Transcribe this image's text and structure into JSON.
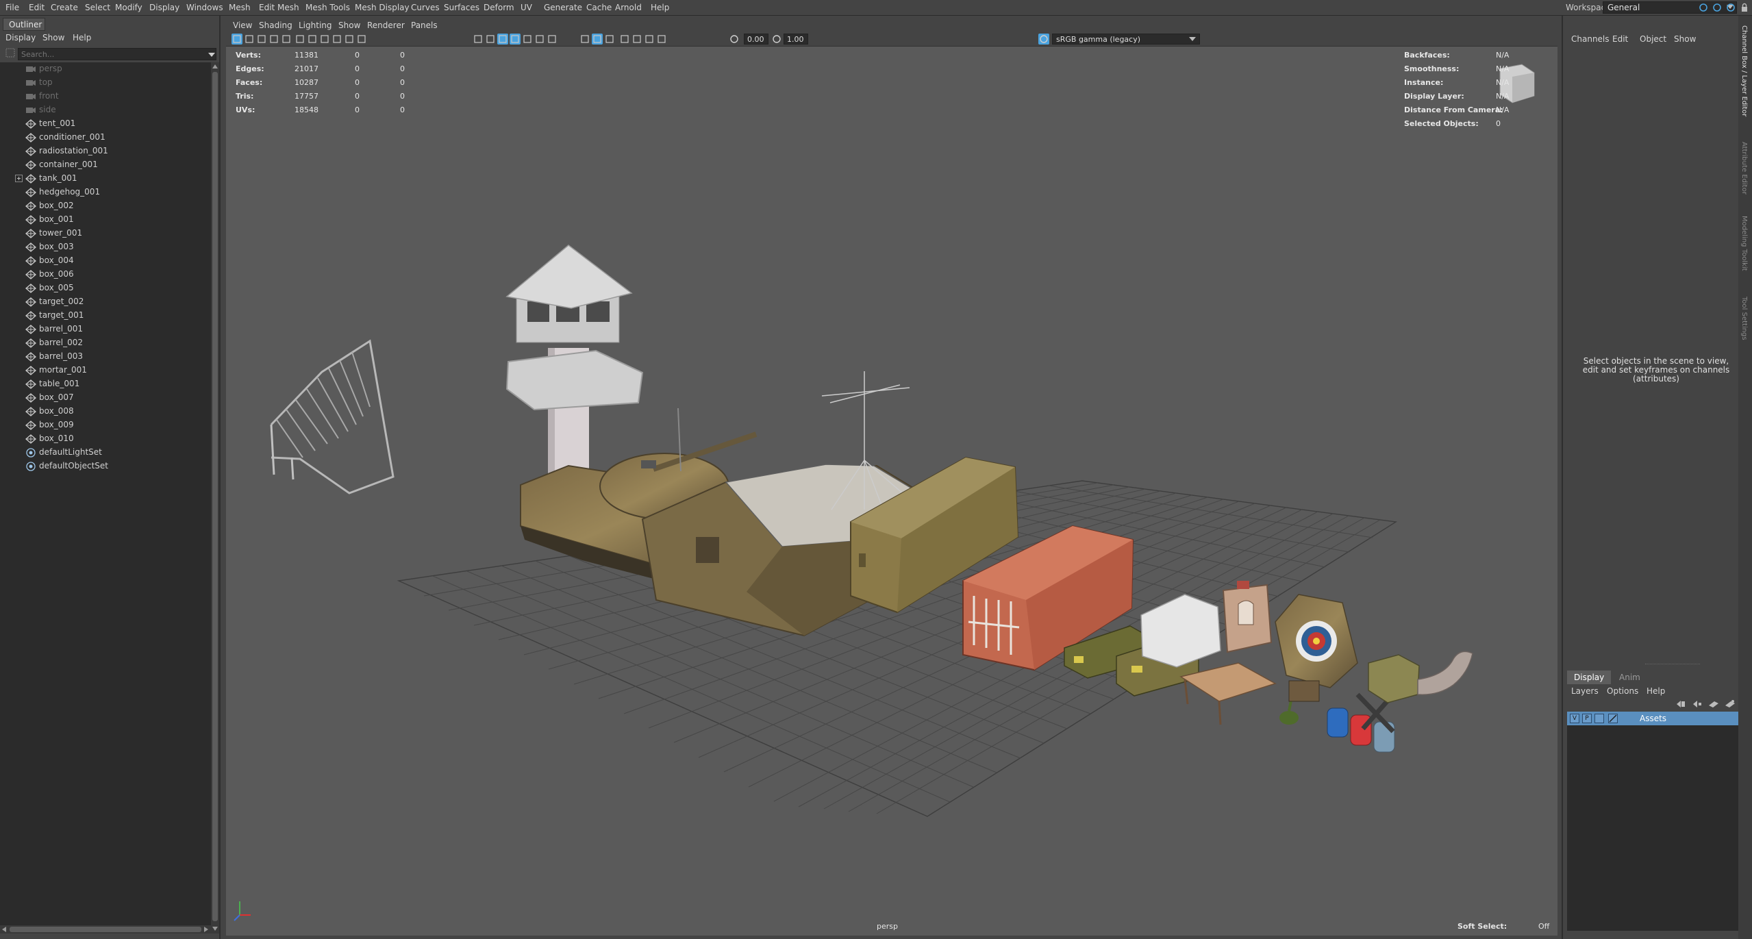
{
  "menubar": {
    "items": [
      "File",
      "Edit",
      "Create",
      "Select",
      "Modify",
      "Display",
      "Windows",
      "Mesh",
      "Edit Mesh",
      "Mesh Tools",
      "Mesh Display",
      "Curves",
      "Surfaces",
      "Deform",
      "UV",
      "Generate",
      "Cache",
      "Arnold",
      "Help"
    ],
    "workspace_label": "Workspace:",
    "workspace_value": "General"
  },
  "outliner": {
    "tab": "Outliner",
    "menu": [
      "Display",
      "Show",
      "Help"
    ],
    "search_placeholder": "Search...",
    "items": [
      {
        "label": "persp",
        "type": "camera"
      },
      {
        "label": "top",
        "type": "camera"
      },
      {
        "label": "front",
        "type": "camera"
      },
      {
        "label": "side",
        "type": "camera"
      },
      {
        "label": "tent_001",
        "type": "mesh"
      },
      {
        "label": "conditioner_001",
        "type": "mesh"
      },
      {
        "label": "radiostation_001",
        "type": "mesh"
      },
      {
        "label": "container_001",
        "type": "mesh"
      },
      {
        "label": "tank_001",
        "type": "group"
      },
      {
        "label": "hedgehog_001",
        "type": "mesh"
      },
      {
        "label": "box_002",
        "type": "mesh"
      },
      {
        "label": "box_001",
        "type": "mesh"
      },
      {
        "label": "tower_001",
        "type": "mesh"
      },
      {
        "label": "box_003",
        "type": "mesh"
      },
      {
        "label": "box_004",
        "type": "mesh"
      },
      {
        "label": "box_006",
        "type": "mesh"
      },
      {
        "label": "box_005",
        "type": "mesh"
      },
      {
        "label": "target_002",
        "type": "mesh"
      },
      {
        "label": "target_001",
        "type": "mesh"
      },
      {
        "label": "barrel_001",
        "type": "mesh"
      },
      {
        "label": "barrel_002",
        "type": "mesh"
      },
      {
        "label": "barrel_003",
        "type": "mesh"
      },
      {
        "label": "mortar_001",
        "type": "mesh"
      },
      {
        "label": "table_001",
        "type": "mesh"
      },
      {
        "label": "box_007",
        "type": "mesh"
      },
      {
        "label": "box_008",
        "type": "mesh"
      },
      {
        "label": "box_009",
        "type": "mesh"
      },
      {
        "label": "box_010",
        "type": "mesh"
      },
      {
        "label": "defaultLightSet",
        "type": "set"
      },
      {
        "label": "defaultObjectSet",
        "type": "set"
      }
    ]
  },
  "viewport": {
    "menu": [
      "View",
      "Shading",
      "Lighting",
      "Show",
      "Renderer",
      "Panels"
    ],
    "exposure": "0.00",
    "gamma": "1.00",
    "color_space": "sRGB gamma (legacy)",
    "stats": [
      {
        "label": "Verts:",
        "v1": "11381",
        "v2": "0",
        "v3": "0"
      },
      {
        "label": "Edges:",
        "v1": "21017",
        "v2": "0",
        "v3": "0"
      },
      {
        "label": "Faces:",
        "v1": "10287",
        "v2": "0",
        "v3": "0"
      },
      {
        "label": "Tris:",
        "v1": "17757",
        "v2": "0",
        "v3": "0"
      },
      {
        "label": "UVs:",
        "v1": "18548",
        "v2": "0",
        "v3": "0"
      }
    ],
    "info": [
      {
        "label": "Backfaces:",
        "value": "N/A"
      },
      {
        "label": "Smoothness:",
        "value": "N/A"
      },
      {
        "label": "Instance:",
        "value": "N/A"
      },
      {
        "label": "Display Layer:",
        "value": "N/A"
      },
      {
        "label": "Distance From Camera:",
        "value": "N/A"
      },
      {
        "label": "Selected Objects:",
        "value": "0"
      }
    ],
    "camera_label": "persp",
    "soft_select_label": "Soft Select:",
    "soft_select_value": "Off"
  },
  "channelbox": {
    "menu": [
      "Channels",
      "Edit",
      "Object",
      "Show"
    ],
    "help_text": "Select objects in the scene to view, edit and set keyframes on channels (attributes)"
  },
  "layers": {
    "tabs": [
      "Display",
      "Anim"
    ],
    "menu": [
      "Layers",
      "Options",
      "Help"
    ],
    "row": {
      "v": "V",
      "p": "P",
      "name": "Assets"
    }
  },
  "side_tabs": [
    "Channel Box / Layer Editor",
    "Attribute Editor",
    "Modeling Toolkit",
    "Tool Settings"
  ],
  "colors": {
    "panel_bg": "#444444",
    "list_bg": "#2b2b2b",
    "viewport_bg": "#5a5a5a",
    "selection": "#5a8fbf"
  }
}
